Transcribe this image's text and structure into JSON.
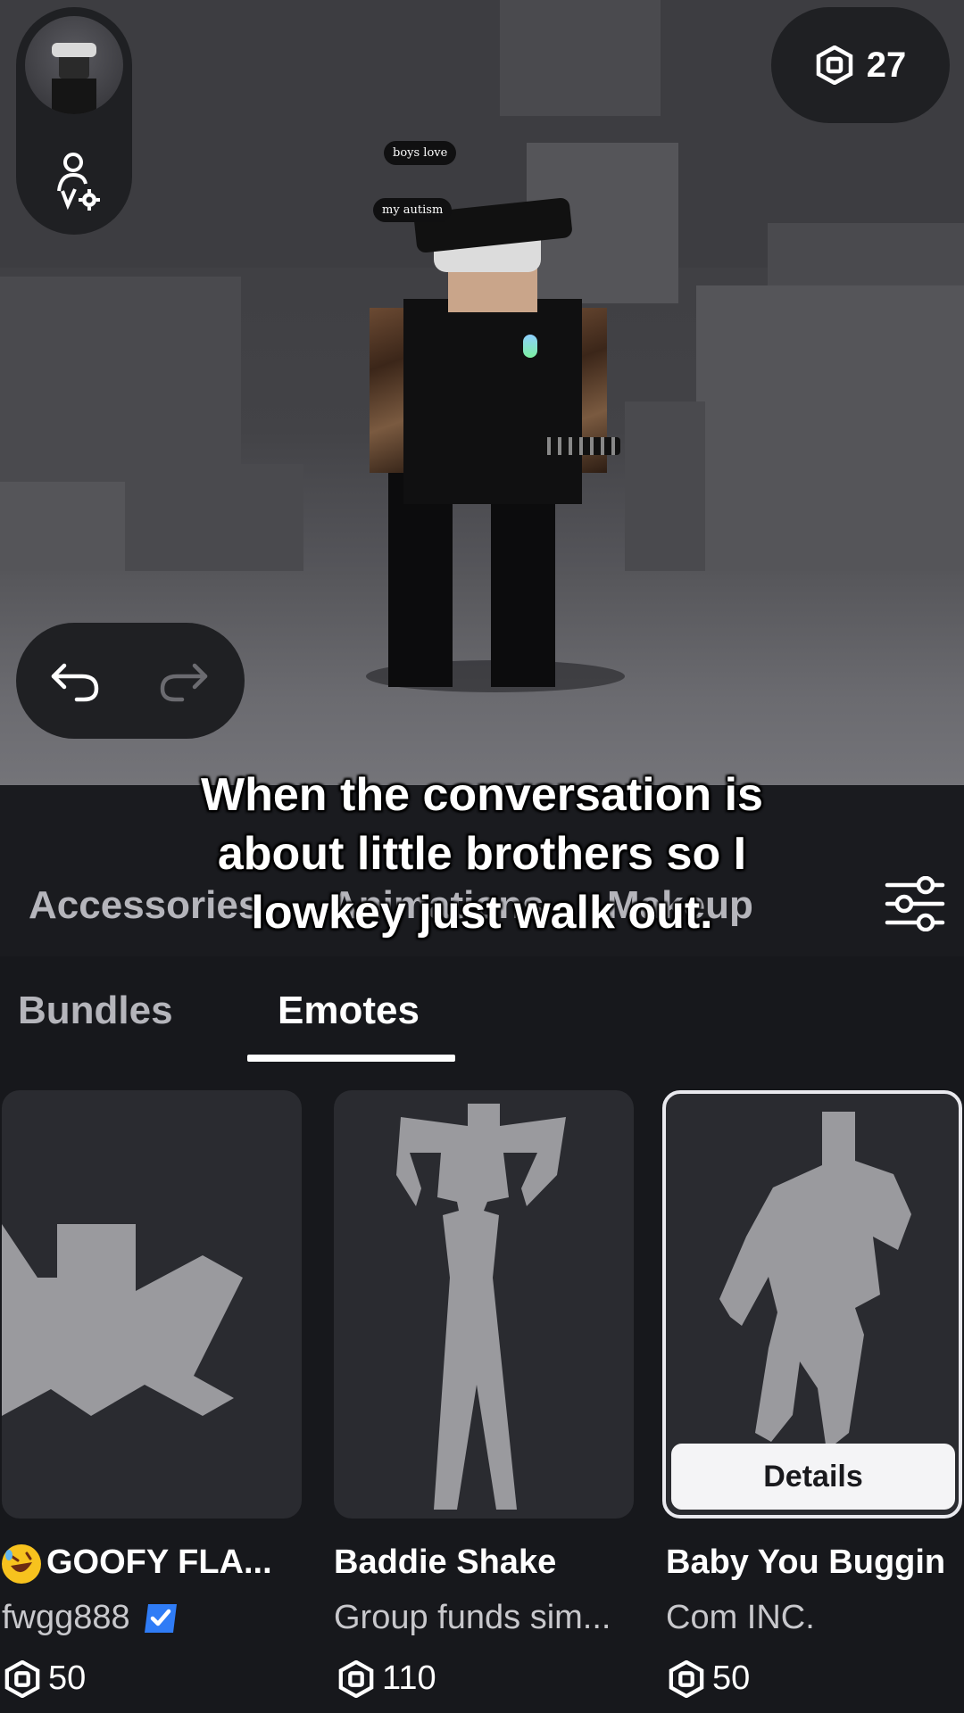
{
  "header": {
    "robux_balance": "27"
  },
  "avatar": {
    "speech_line_1": "boys love",
    "speech_line_2": "my autism"
  },
  "caption": {
    "line1": "When the conversation is",
    "line2": "about little brothers so I",
    "line3": "lowkey just walk out."
  },
  "categories": {
    "items": [
      {
        "label": "Accessories"
      },
      {
        "label": "Animations"
      },
      {
        "label": "Makeup"
      }
    ]
  },
  "subtabs": {
    "items": [
      {
        "label": "Bundles",
        "active": false
      },
      {
        "label": "Emotes",
        "active": true
      }
    ]
  },
  "items": [
    {
      "name": "GOOFY FLA...",
      "creator": "fwgg888",
      "creator_verified": true,
      "price": "50",
      "emoji": "rolling-on-floor-laughing"
    },
    {
      "name": "Baddie Shake",
      "creator": "Group funds sim...",
      "creator_verified": false,
      "price": "110"
    },
    {
      "name": "Baby You Buggin",
      "creator": "Com INC.",
      "creator_verified": false,
      "price": "50",
      "selected": true,
      "details_label": "Details"
    }
  ],
  "colors": {
    "background": "#17181c",
    "card": "#2a2b30",
    "pill": "#1f2023",
    "silhouette": "#9a9a9e",
    "verified": "#2f7cf6"
  },
  "icons": [
    "avatar-settings-icon",
    "robux-icon",
    "undo-icon",
    "redo-icon",
    "filter-sliders-icon",
    "verified-badge-icon"
  ]
}
